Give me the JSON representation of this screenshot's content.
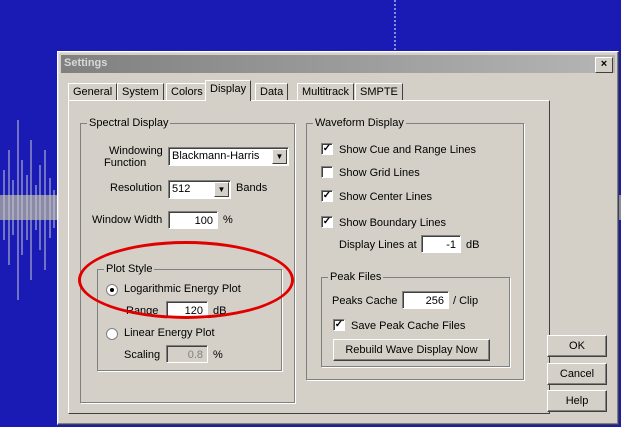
{
  "dialog": {
    "title": "Settings",
    "close_label": "×"
  },
  "tabs": [
    {
      "label": "General"
    },
    {
      "label": "System"
    },
    {
      "label": "Colors"
    },
    {
      "label": "Display"
    },
    {
      "label": "Data"
    },
    {
      "label": "Multitrack"
    },
    {
      "label": "SMPTE"
    }
  ],
  "spectral": {
    "legend": "Spectral Display",
    "windowing_label_1": "Windowing",
    "windowing_label_2": "Function",
    "windowing_value": "Blackmann-Harris",
    "resolution_label": "Resolution",
    "resolution_value": "512",
    "resolution_unit": "Bands",
    "window_width_label": "Window Width",
    "window_width_value": "100",
    "window_width_unit": "%"
  },
  "plot_style": {
    "legend": "Plot Style",
    "log_label": "Logarithmic Energy Plot",
    "range_label": "Range",
    "range_value": "120",
    "range_unit": "dB",
    "linear_label": "Linear Energy Plot",
    "scaling_label": "Scaling",
    "scaling_value": "0.8",
    "scaling_unit": "%"
  },
  "waveform": {
    "legend": "Waveform Display",
    "cue_label": "Show Cue and Range Lines",
    "grid_label": "Show Grid Lines",
    "center_label": "Show Center Lines",
    "boundary_label": "Show Boundary Lines",
    "display_lines_label": "Display Lines at",
    "display_lines_value": "-1",
    "display_lines_unit": "dB"
  },
  "peak_files": {
    "legend": "Peak Files",
    "cache_label": "Peaks Cache",
    "cache_value": "256",
    "cache_unit": "/ Clip",
    "save_label": "Save Peak Cache Files",
    "rebuild_label": "Rebuild Wave Display Now"
  },
  "buttons": {
    "ok": "OK",
    "cancel": "Cancel",
    "help": "Help"
  },
  "colors": {
    "background": "#1a1ab4",
    "annotation": "#e00000"
  }
}
